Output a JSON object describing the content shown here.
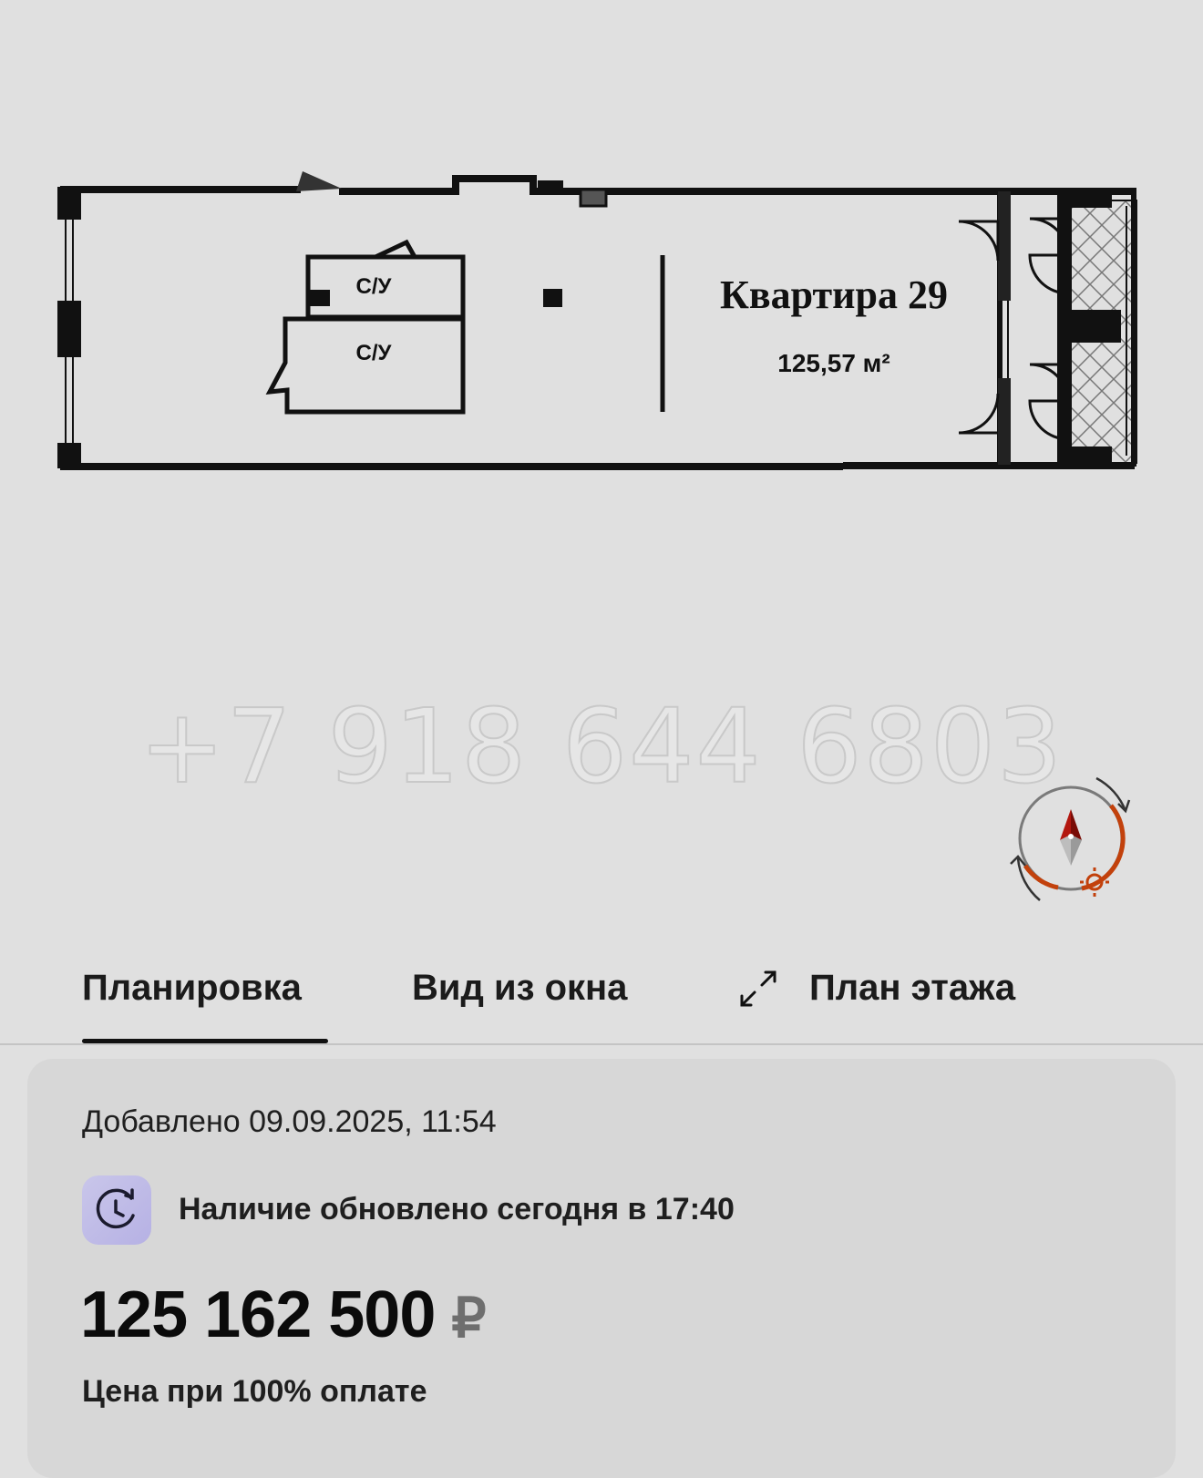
{
  "plan": {
    "bathroom_1": "С/У",
    "bathroom_2": "С/У",
    "apartment_name": "Квартира 29",
    "area": "125,57 м²"
  },
  "watermark": "+7 918 644 6803",
  "tabs": [
    {
      "label": "Планировка",
      "active": true
    },
    {
      "label": "Вид из окна",
      "active": false
    },
    {
      "label": "План этажа",
      "active": false
    }
  ],
  "card": {
    "added": "Добавлено 09.09.2025, 11:54",
    "availability": "Наличие обновлено сегодня в 17:40",
    "price": "125 162 500",
    "currency": "₽",
    "price_note": "Цена при 100% оплате"
  },
  "icons": {
    "compass": "compass-icon",
    "expand": "expand-icon",
    "availability": "clock-refresh-icon"
  },
  "colors": {
    "background": "#e0e0e0",
    "card": "#d7d7d7",
    "compass_red": "#b3170f",
    "compass_orange": "#c2410c",
    "clock_bg": "#bcb8e6"
  }
}
